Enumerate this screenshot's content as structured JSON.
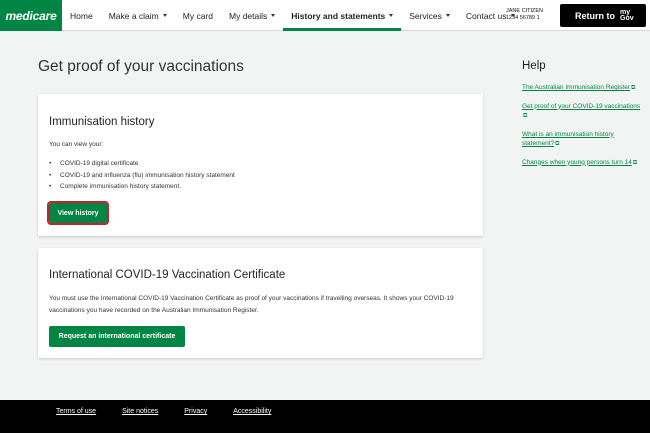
{
  "brand": {
    "logo_text": "medicare",
    "accent": "#008545"
  },
  "nav": {
    "items": [
      {
        "label": "Home",
        "dropdown": false
      },
      {
        "label": "Make a claim",
        "dropdown": true
      },
      {
        "label": "My card",
        "dropdown": false
      },
      {
        "label": "My details",
        "dropdown": true
      },
      {
        "label": "History and statements",
        "dropdown": true,
        "active": true
      },
      {
        "label": "Services",
        "dropdown": true
      },
      {
        "label": "Contact us",
        "dropdown": true
      }
    ]
  },
  "user": {
    "name": "JANE CITIZEN",
    "number": "1234 56789 1"
  },
  "mygov": {
    "label": "Return to",
    "logo_top": "my",
    "logo_bottom": "Gov"
  },
  "page": {
    "title": "Get proof of your vaccinations"
  },
  "immunisation": {
    "heading": "Immunisation history",
    "intro": "You can view your:",
    "items": [
      "COVID-19 digital certificate",
      "COVID-19 and influenza (flu) immunisation history statement",
      "Complete immunisation history statement."
    ],
    "button": "View history"
  },
  "international": {
    "heading": "International COVID-19 Vaccination Certificate",
    "description": "You must use the International COVID-19 Vaccination Certificate as proof of your vaccinations if travelling overseas. It shows your COVID-19 vaccinations you have recorded on the Australian Immunisation Register.",
    "button": "Request an international certificate"
  },
  "help": {
    "title": "Help",
    "links": [
      "The Australian Immunisation Register",
      "Get proof of your COVID-19 vaccinations",
      "What is an immunisation history statement?",
      "Changes when young persons turn 14"
    ]
  },
  "footer": {
    "links": [
      "Terms of use",
      "Site notices",
      "Privacy",
      "Accessibility"
    ]
  }
}
